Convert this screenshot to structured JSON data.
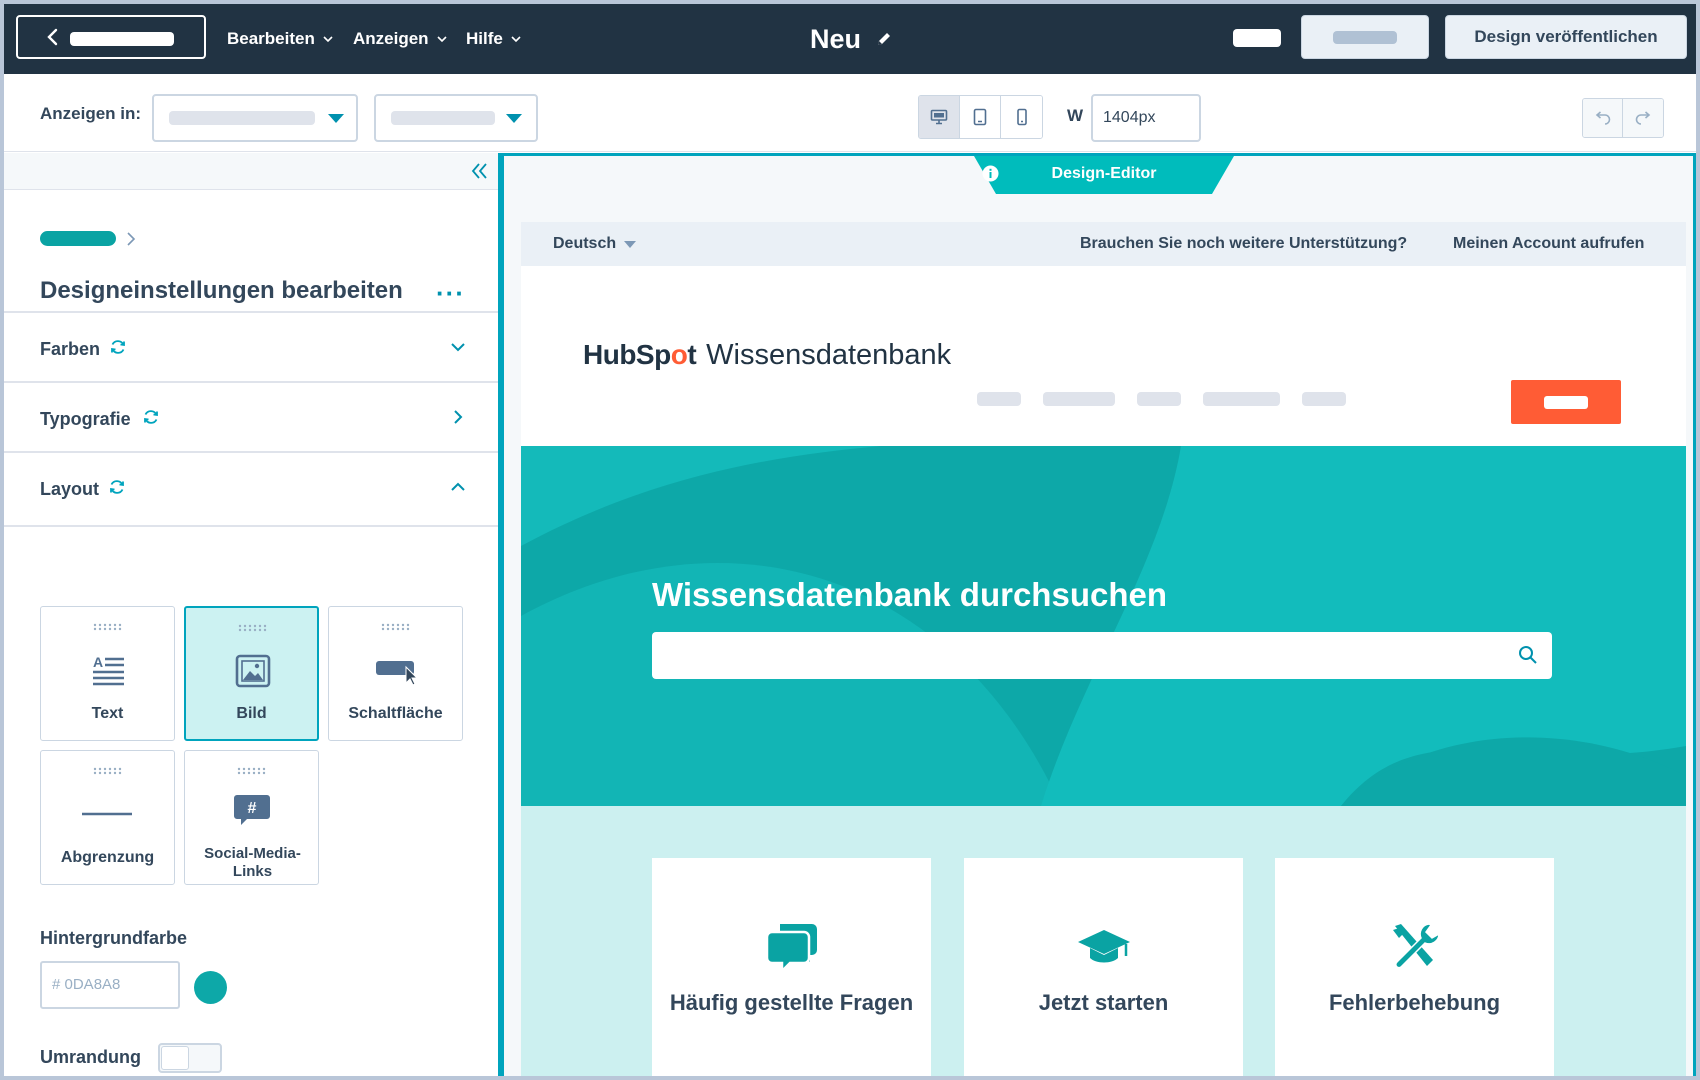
{
  "topbar": {
    "menus": [
      "Bearbeiten",
      "Anzeigen",
      "Hilfe"
    ],
    "title": "Neu",
    "publish_label": "Design veröffentlichen"
  },
  "toolbar": {
    "view_in_label": "Anzeigen in:",
    "width_label": "W",
    "width_value": "1404px"
  },
  "sidebar": {
    "panel_title": "Designeinstellungen bearbeiten",
    "more_label": "···",
    "sections": [
      {
        "label": "Farben",
        "state": "collapsed"
      },
      {
        "label": "Typografie",
        "state": "navigate"
      },
      {
        "label": "Layout",
        "state": "expanded"
      }
    ],
    "modules": [
      {
        "label": "Text",
        "icon": "text-icon",
        "selected": false
      },
      {
        "label": "Bild",
        "icon": "image-icon",
        "selected": true
      },
      {
        "label": "Schaltfläche",
        "icon": "button-icon",
        "selected": false
      },
      {
        "label": "Abgrenzung",
        "icon": "divider-icon",
        "selected": false
      },
      {
        "label": "Social-Media-Links",
        "icon": "hashtag-icon",
        "selected": false
      }
    ],
    "background_color_label": "Hintergrundfarbe",
    "background_color_placeholder": "# 0DA8A8",
    "border_label": "Umrandung",
    "border_enabled": false
  },
  "canvas": {
    "editor_tab_label": "Design-Editor",
    "utility": {
      "language": "Deutsch",
      "help_link": "Brauchen Sie noch weitere Unterstützung?",
      "account_link": "Meinen Account aufrufen"
    },
    "logo": {
      "brand_a": "HubSp",
      "brand_o": "o",
      "brand_b": "t",
      "product": "Wissensdatenbank"
    },
    "hero_title": "Wissensdatenbank durchsuchen",
    "cards": [
      "Häufig gestellte Fragen",
      "Jetzt starten",
      "Fehlerbehebung"
    ]
  },
  "colors": {
    "topbar": "#213343",
    "accent_teal": "#0da8a8",
    "cta_orange": "#ff5c35",
    "selected_tile": "#ccf2f2",
    "link_teal": "#0091ae"
  }
}
